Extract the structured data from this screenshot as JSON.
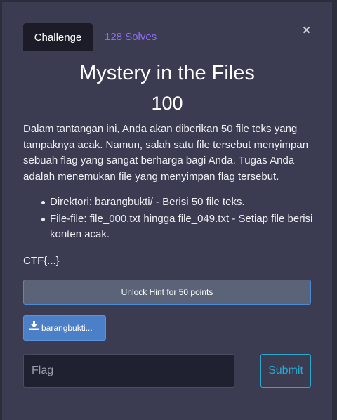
{
  "modal": {
    "close_symbol": "×",
    "tabs": [
      {
        "label": "Challenge"
      },
      {
        "label": "128 Solves"
      }
    ],
    "title": "Mystery in the Files",
    "points": "100",
    "description": "Dalam tantangan ini, Anda akan diberikan 50 file teks yang tampaknya acak. Namun, salah satu file tersebut menyimpan sebuah flag yang sangat berharga bagi Anda. Tugas Anda adalah menemukan file yang menyimpan flag tersebut.",
    "bullets": [
      "Direktori: barangbukti/ - Berisi 50 file teks.",
      "File-file: file_000.txt hingga file_049.txt - Setiap file berisi konten acak."
    ],
    "flag_format": "CTF{...}",
    "hint_button": "Unlock Hint for 50 points",
    "file_button": "barangbukti...",
    "flag_placeholder": "Flag",
    "submit_label": "Submit"
  },
  "colors": {
    "background": "#2c2d3d",
    "modal_bg": "#3b3c52",
    "active_tab": "#1b1c28",
    "solves_link": "#8f6cf6",
    "hint_button": "#5b6378",
    "file_button": "#4b80c8",
    "submit": "#2aa9cf"
  },
  "icons": {
    "close": "close-icon",
    "download": "download-icon"
  }
}
